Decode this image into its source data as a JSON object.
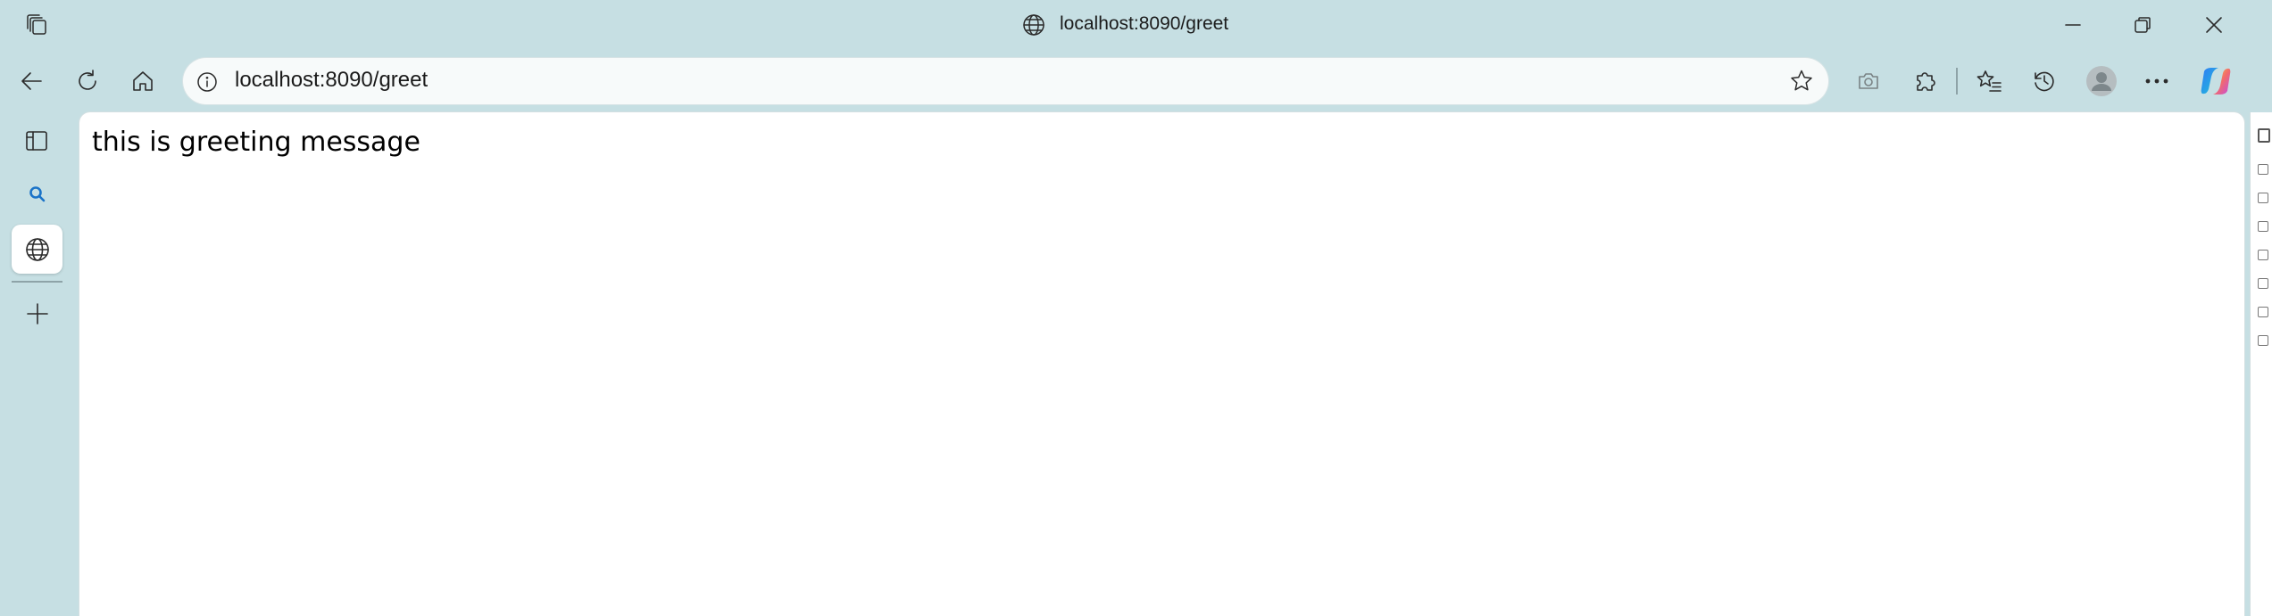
{
  "window": {
    "title": "localhost:8090/greet"
  },
  "toolbar": {
    "url": "localhost:8090/greet",
    "icons": [
      "back-icon",
      "refresh-icon",
      "home-icon",
      "site-info-icon",
      "favorite-star-icon",
      "screenshot-icon",
      "extensions-icon",
      "favorites-icon",
      "history-icon",
      "profile-icon",
      "more-icon",
      "copilot-icon"
    ]
  },
  "sidebar": {
    "icons": [
      "tab-actions-icon",
      "search-icon",
      "globe-icon",
      "add-icon"
    ]
  },
  "page": {
    "message": "this is greeting message"
  },
  "colors": {
    "chrome_bg": "#c6dfe3",
    "page_bg": "#ffffff",
    "search_accent": "#1a73c8"
  }
}
